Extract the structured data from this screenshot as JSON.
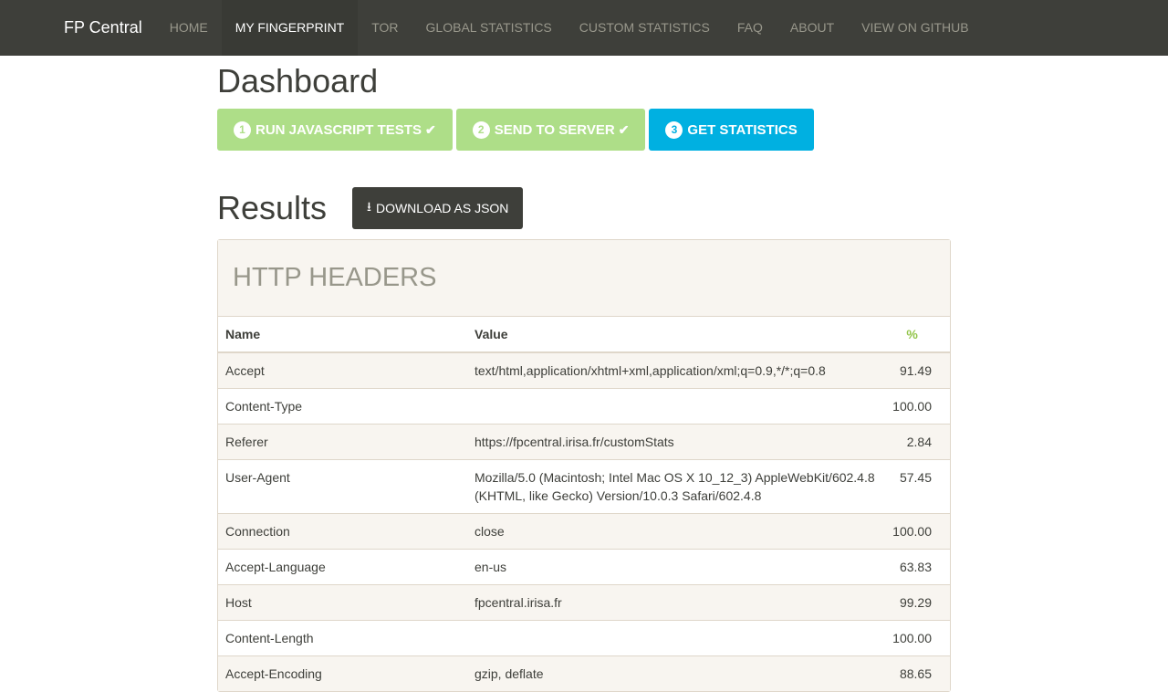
{
  "nav": {
    "brand": "FP Central",
    "items": [
      "HOME",
      "MY FINGERPRINT",
      "TOR",
      "GLOBAL STATISTICS",
      "CUSTOM STATISTICS",
      "FAQ",
      "ABOUT",
      "VIEW ON GITHUB"
    ]
  },
  "title": "Dashboard",
  "steps": [
    {
      "num": "1",
      "label": "RUN JAVASCRIPT TESTS"
    },
    {
      "num": "2",
      "label": "SEND TO SERVER"
    },
    {
      "num": "3",
      "label": "GET STATISTICS"
    }
  ],
  "results_title": "Results",
  "download_label": "DOWNLOAD AS JSON",
  "panel_title": "HTTP HEADERS",
  "columns": [
    "Name",
    "Value",
    "%"
  ],
  "rows": [
    [
      "Accept",
      "text/html,application/xhtml+xml,application/xml;q=0.9,*/*;q=0.8",
      "91.49"
    ],
    [
      "Content-Type",
      "",
      "100.00"
    ],
    [
      "Referer",
      "https://fpcentral.irisa.fr/customStats",
      "2.84"
    ],
    [
      "User-Agent",
      "Mozilla/5.0 (Macintosh; Intel Mac OS X 10_12_3) AppleWebKit/602.4.8 (KHTML, like Gecko) Version/10.0.3 Safari/602.4.8",
      "57.45"
    ],
    [
      "Connection",
      "close",
      "100.00"
    ],
    [
      "Accept-Language",
      "en-us",
      "63.83"
    ],
    [
      "Host",
      "fpcentral.irisa.fr",
      "99.29"
    ],
    [
      "Content-Length",
      "",
      "100.00"
    ],
    [
      "Accept-Encoding",
      "gzip, deflate",
      "88.65"
    ]
  ]
}
